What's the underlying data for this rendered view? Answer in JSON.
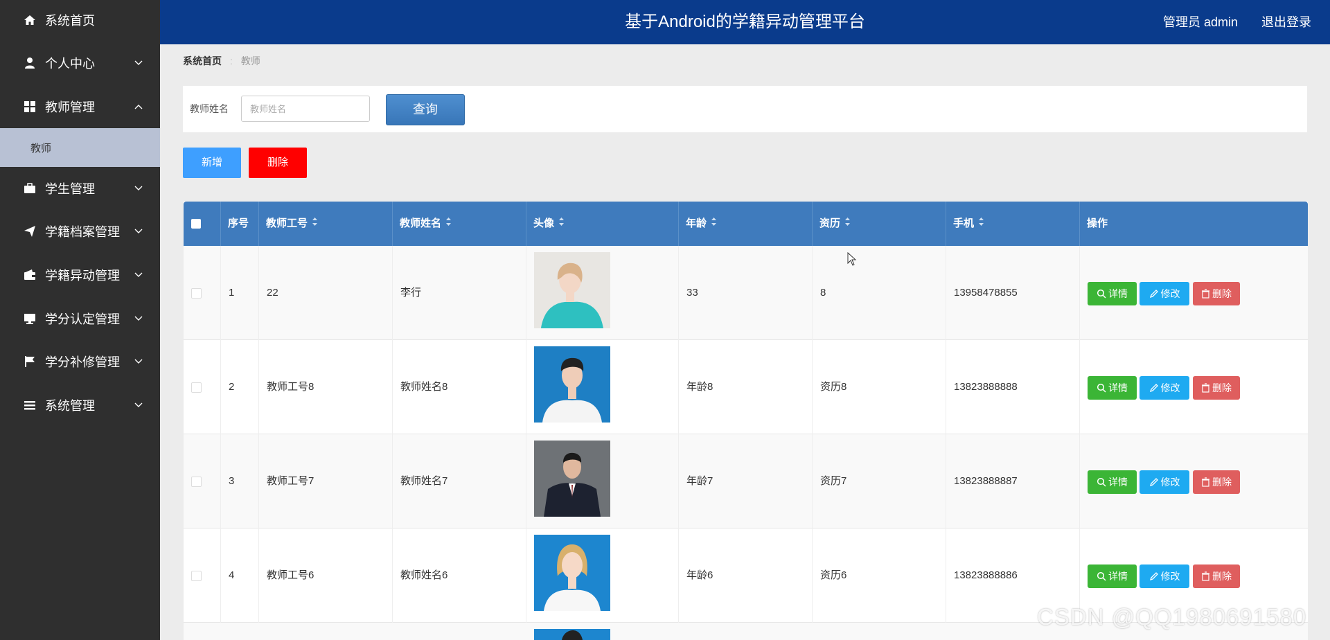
{
  "header": {
    "title": "基于Android的学籍异动管理平台",
    "user_label": "管理员 admin",
    "logout_label": "退出登录"
  },
  "sidebar": {
    "items": [
      {
        "label": "系统首页",
        "icon": "home-icon"
      },
      {
        "label": "个人中心",
        "icon": "user-icon"
      },
      {
        "label": "教师管理",
        "icon": "grid-icon"
      },
      {
        "label": "学生管理",
        "icon": "briefcase-icon"
      },
      {
        "label": "学籍档案管理",
        "icon": "send-icon"
      },
      {
        "label": "学籍异动管理",
        "icon": "wallet-icon"
      },
      {
        "label": "学分认定管理",
        "icon": "monitor-icon"
      },
      {
        "label": "学分补修管理",
        "icon": "flag-icon"
      },
      {
        "label": "系统管理",
        "icon": "list-icon"
      }
    ],
    "sub_item": "教师"
  },
  "breadcrumb": {
    "home": "系统首页",
    "current": "教师"
  },
  "search": {
    "label": "教师姓名",
    "placeholder": "教师姓名",
    "value": "",
    "button": "查询"
  },
  "actions": {
    "add": "新增",
    "delete": "删除"
  },
  "table": {
    "headers": [
      "序号",
      "教师工号",
      "教师姓名",
      "头像",
      "年龄",
      "资历",
      "手机",
      "操作"
    ],
    "rows": [
      {
        "index": "1",
        "id": "22",
        "name": "李行",
        "age": "33",
        "seniority": "8",
        "phone": "13958478855"
      },
      {
        "index": "2",
        "id": "教师工号8",
        "name": "教师姓名8",
        "age": "年龄8",
        "seniority": "资历8",
        "phone": "13823888888"
      },
      {
        "index": "3",
        "id": "教师工号7",
        "name": "教师姓名7",
        "age": "年龄7",
        "seniority": "资历7",
        "phone": "13823888887"
      },
      {
        "index": "4",
        "id": "教师工号6",
        "name": "教师姓名6",
        "age": "年龄6",
        "seniority": "资历6",
        "phone": "13823888886"
      }
    ],
    "row_actions": {
      "detail": "详情",
      "edit": "修改",
      "delete": "删除"
    }
  },
  "watermark": "CSDN @QQ1980691580",
  "colors": {
    "header_bg": "#0a3b8c",
    "sidebar_bg": "#2f2f2f",
    "table_header": "#3f7bbd",
    "add_button": "#3e9fff",
    "delete_button": "#ff0000",
    "detail_button": "#3bb536",
    "edit_button": "#1eaaf1",
    "row_delete_button": "#df5e5e"
  }
}
